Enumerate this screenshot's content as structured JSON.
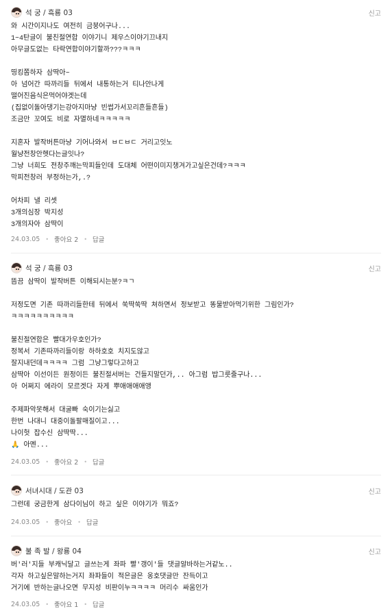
{
  "comments": [
    {
      "nickname": "석 궁 / 흑룡 03",
      "report": "신고",
      "body": "와 시간이지나도 여전히 금붕어구나...\n1~4탄글이 불친절연합 이야기니 제우스이야기끄내지\n아무글도없는 타락연합이야기할까???ㅋㅋㅋ\n\n띵킹쫌하자 삼딱아~\n아 넘어간 따까리들 뒤에서 내통하는거 티나안나게\n떨어진음식은먹어야겟는데\n(집없이돌아댕기는강아지마냥 빈썹가서꼬리흔들흔들)\n조금만 꼬여도 비로 자멸하네ㅋㅋㅋㅋㅋ\n\n지혼자 발작버튼마냥 기어나와서 ㅂㄷㅂㄷ 거리고잇노\n월냥전창안헷다는글잇나?\n그냥 너희도 전창주깨는막피들인데 도대체 어떤이미지챙겨가고싶은건데?ㅋㅋㅋ\n막피전창러 부정하는가,.?\n\n어차피 낼 리셋\n3개의심장 박지성\n3개의자아 삼딱이",
      "date": "24.03.05",
      "like": "좋아요 2",
      "reply": "답글"
    },
    {
      "nickname": "석 궁 / 흑룡 03",
      "report": "신고",
      "body": "뜸끔 삼딱이 발작버튼 이해되시는분?ㅋㄱ\n\n저정도면 기존 따까리들한테 뒤에서 쑥딱쑥딱 쳐하면서 정보받고 똥물받아먹기위한 그림인가?\nㅋㅋㅋㅋㅋㅋㅋㅋㅋㅋ\n\n불친절연합은 빨대가우호인가?\n정복서 기존따까리들이랑 하하호호 치지도않고\n잘지내던데ㅋㅋㅋㅋ 그럼 그냥그렇다고하고\n삼딱아 이선이든 원정이든 불친절서버는 건들지말던가,.. 아그럼 밥그릇줄구나...\n아 어쩌지 에라이 모르겟다 자게 뿌애애애애앵\n\n주제파악못해서 대굴빠 숙이기는싫고\n한번 나대니 대중이돌팔매질이고...\n나이헛 잡수신 삼딱딱...\n🙏 아멘...",
      "date": "24.03.05",
      "like": "좋아요 2",
      "reply": "답글"
    },
    {
      "nickname": "서녀시대 / 도관 03",
      "report": "신고",
      "body": "그런데 궁금한게 삼다이님이 하고 싶은 이야기가 뭐죠?",
      "date": "24.03.05",
      "like": "좋아요",
      "reply": "답글"
    },
    {
      "nickname": "불 족 발 / 왕룡 04",
      "report": "신고",
      "body": "버'러'지들 부캐닉달고 글쓰는게 좌파 빨'갱이'들 댓글알바하는거같노..\n각자 하고싶은말하는거지 좌파들이 적은글은 옹호댓글만 잔득이고\n거기에 반하는글나오면 무지성 비판이누ㅋㅋㅋㅋ 머리수 싸움인가",
      "date": "24.03.05",
      "like": "좋아요 1",
      "reply": "답글"
    }
  ],
  "colors": {
    "text": "#222222",
    "meta": "#888888",
    "divider": "#ececec"
  },
  "icons": {
    "avatar": "user-avatar-icon"
  }
}
